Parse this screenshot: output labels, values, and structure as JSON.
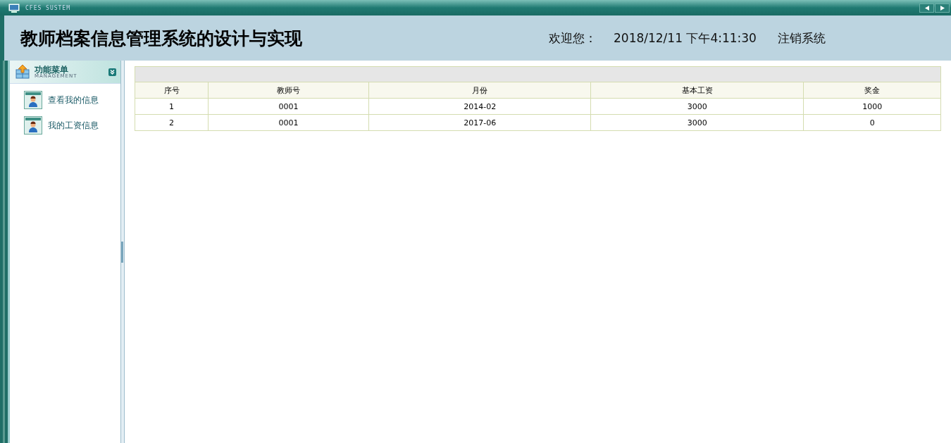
{
  "window": {
    "title": "CFES SUSTEM"
  },
  "header": {
    "title": "教师档案信息管理系统的设计与实现",
    "welcome": "欢迎您：",
    "datetime": "2018/12/11 下午4:11:30",
    "logout": "注销系统"
  },
  "sidebar": {
    "title": "功能菜单",
    "subtitle": "MANAGEMENT",
    "items": [
      {
        "label": "查看我的信息"
      },
      {
        "label": "我的工资信息"
      }
    ]
  },
  "table": {
    "columns": [
      "序号",
      "教师号",
      "月份",
      "基本工资",
      "奖金"
    ],
    "rows": [
      [
        "1",
        "0001",
        "2014-02",
        "3000",
        "1000"
      ],
      [
        "2",
        "0001",
        "2017-06",
        "3000",
        "0"
      ]
    ]
  }
}
